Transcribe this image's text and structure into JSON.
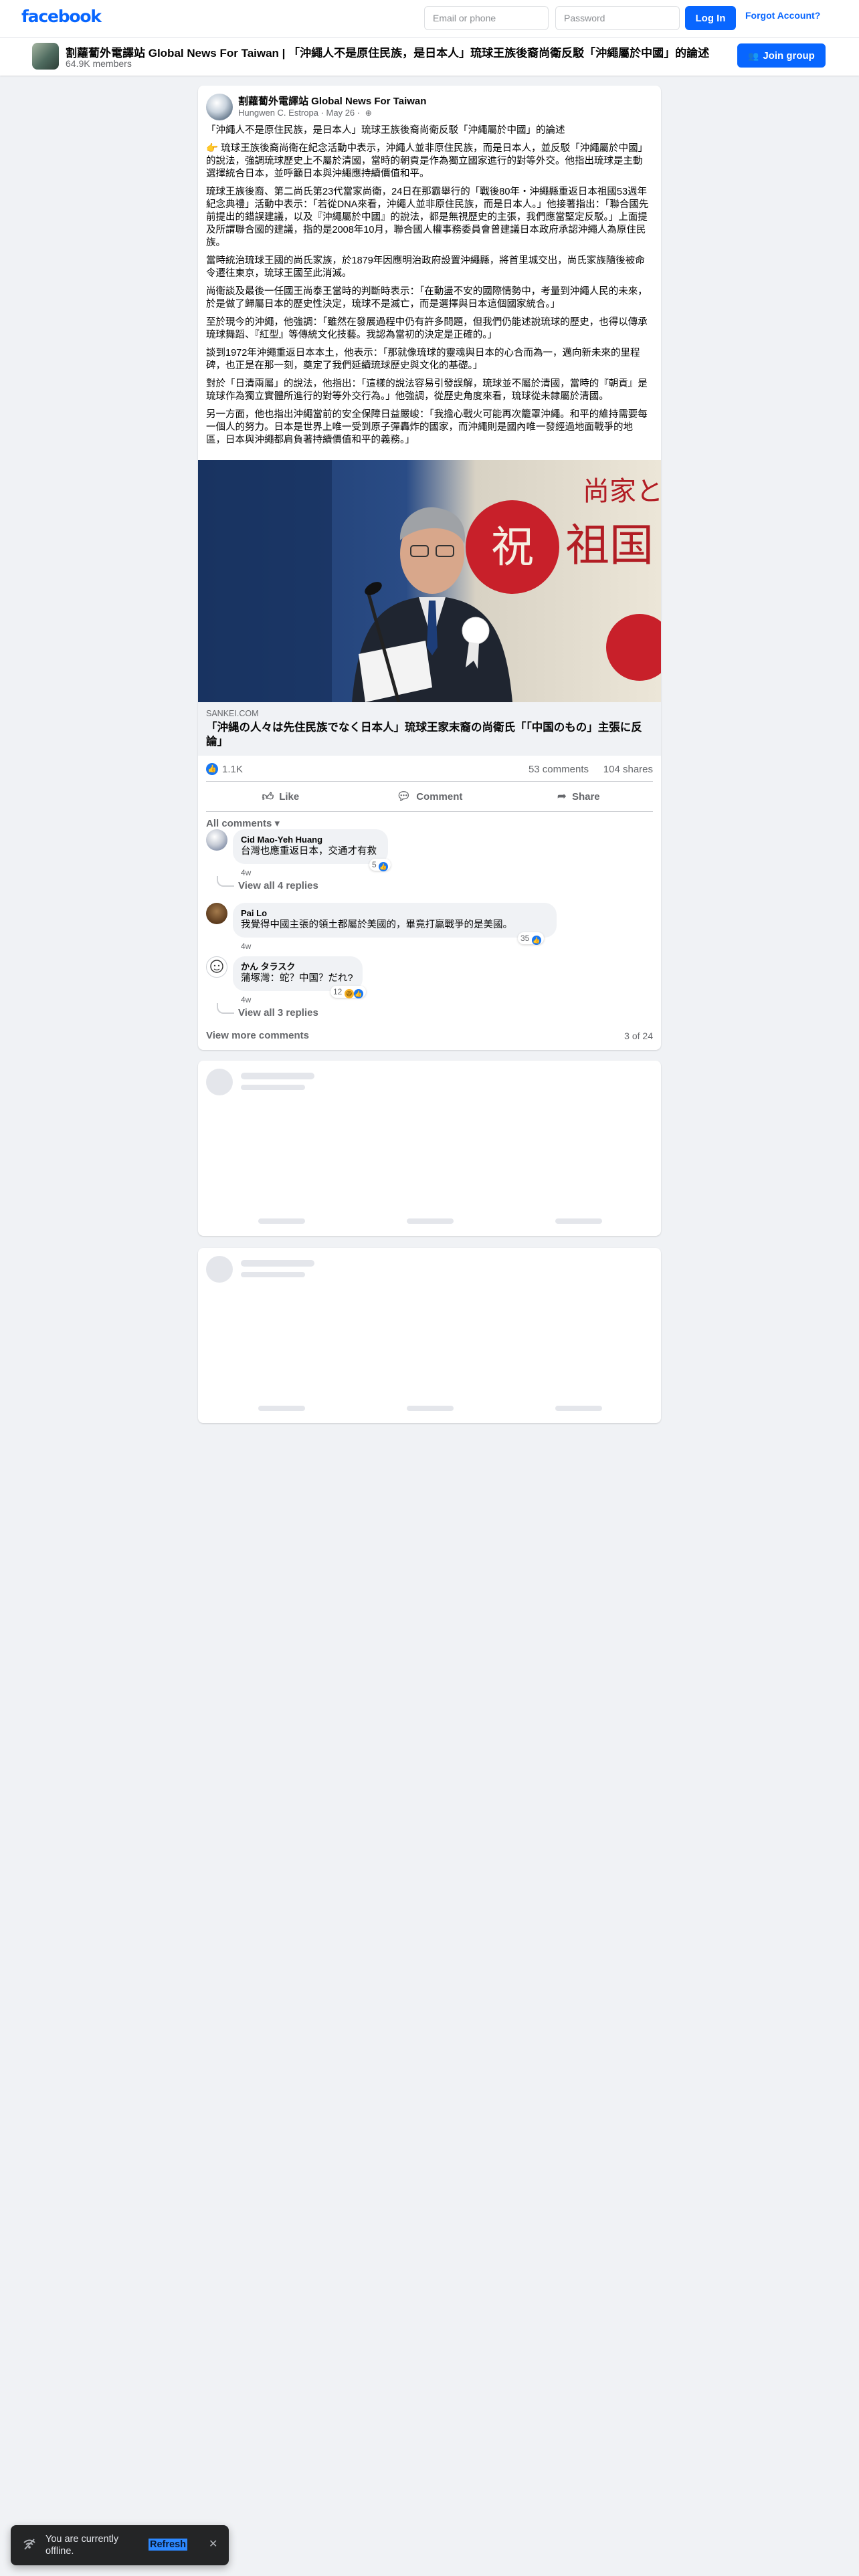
{
  "nav": {
    "logo": "facebook",
    "email_placeholder": "Email or phone",
    "password_placeholder": "Password",
    "login_label": "Log In",
    "forgot_label": "Forgot Account?"
  },
  "group": {
    "title": "割蘿蔔外電譯站 Global News For Taiwan | 「沖繩人不是原住民族，是日本人」琉球王族後裔尚衛反駁「沖繩屬於中國」的論述",
    "members": "64.9K members",
    "join_label": "Join group"
  },
  "post": {
    "author": "割蘿蔔外電譯站 Global News For Taiwan",
    "byline": "Hungwen C. Estropa",
    "date": "May 26",
    "paragraphs": [
      "「沖繩人不是原住民族，是日本人」琉球王族後裔尚衛反駁「沖繩屬於中國」的論述",
      "👉 琉球王族後裔尚衛在紀念活動中表示，沖繩人並非原住民族，而是日本人，並反駁「沖繩屬於中國」的說法，強調琉球歷史上不屬於清國，當時的朝貢是作為獨立國家進行的對等外交。他指出琉球是主動選擇統合日本，並呼籲日本與沖繩應持續價值和平。",
      "琉球王族後裔、第二尚氏第23代當家尚衛，24日在那霸舉行的「戰後80年・沖繩縣重返日本祖國53週年紀念典禮」活動中表示：「若從DNA來看，沖繩人並非原住民族，而是日本人。」他接著指出：「聯合國先前提出的錯誤建議，以及『沖繩屬於中國』的說法，都是無視歷史的主張，我們應當堅定反駁。」上面提及所謂聯合國的建議，指的是2008年10月，聯合國人權事務委員會曾建議日本政府承認沖繩人為原住民族。",
      "當時統治琉球王國的尚氏家族，於1879年因應明治政府設置沖繩縣，將首里城交出，尚氏家族隨後被命令遷往東京，琉球王國至此消滅。",
      "尚衛談及最後一任國王尚泰王當時的判斷時表示：「在動盪不安的國際情勢中，考量到沖繩人民的未來，於是做了歸屬日本的歷史性決定，琉球不是滅亡，而是選擇與日本這個國家統合。」",
      "至於現今的沖繩，他強調：「雖然在發展過程中仍有許多問題，但我們仍能述說琉球的歷史，也得以傳承琉球舞蹈、『紅型』等傳統文化技藝。我認為當初的決定是正確的。」",
      "談到1972年沖繩重返日本本土，他表示：「那就像琉球的靈魂與日本的心合而為一，邁向新未來的里程碑，也正是在那一刻，奠定了我們延續琉球歷史與文化的基礎。」",
      "對於「日清兩屬」的說法，他指出：「這樣的說法容易引發誤解，琉球並不屬於清國，當時的『朝貢』是琉球作為獨立實體所進行的對等外交行為。」他強調，從歷史角度來看，琉球從未隸屬於清國。",
      "另一方面，他也指出沖繩當前的安全保障日益嚴峻：「我擔心戰火可能再次籠罩沖繩。和平的維持需要每一個人的努力。日本是世界上唯一受到原子彈轟炸的國家，而沖繩則是國內唯一發經過地面戰爭的地區，日本與沖繩都肩負著持續價值和平的義務。」"
    ],
    "image_sign_text": "祝",
    "image_banner_text": "祖国",
    "image_top_text": "尚家と",
    "link_domain": "SANKEI.COM",
    "link_title": "「沖縄の人々は先住民族でなく日本人」琉球王家末裔の尚衛氏「「中国のもの」主張に反論」",
    "like_count": "1.1K",
    "comment_count": "53 comments",
    "share_count": "104 shares",
    "actions": {
      "like": "Like",
      "comment": "Comment",
      "share": "Share"
    },
    "all_comments_label": "All comments",
    "comments": [
      {
        "name": "Cid Mao-Yeh Huang",
        "text": "台灣也應重返日本，交通才有救",
        "time": "4w",
        "reactions": "5",
        "replies": "View all 4 replies"
      },
      {
        "name": "Pai Lo",
        "text": "我覺得中國主張的領土都屬於美國的，畢竟打贏戰爭的是美國。",
        "time": "4w",
        "reactions": "35"
      },
      {
        "name": "かん タラスク",
        "text": "蒲塚灣：蛇？中国？だれ?",
        "time": "4w",
        "reactions": "12",
        "replies": "View all 3 replies"
      }
    ],
    "view_more_label": "View more comments",
    "page_count": "3 of 24"
  },
  "toast": {
    "text": "You are currently offline.",
    "refresh_label": "Refresh"
  }
}
